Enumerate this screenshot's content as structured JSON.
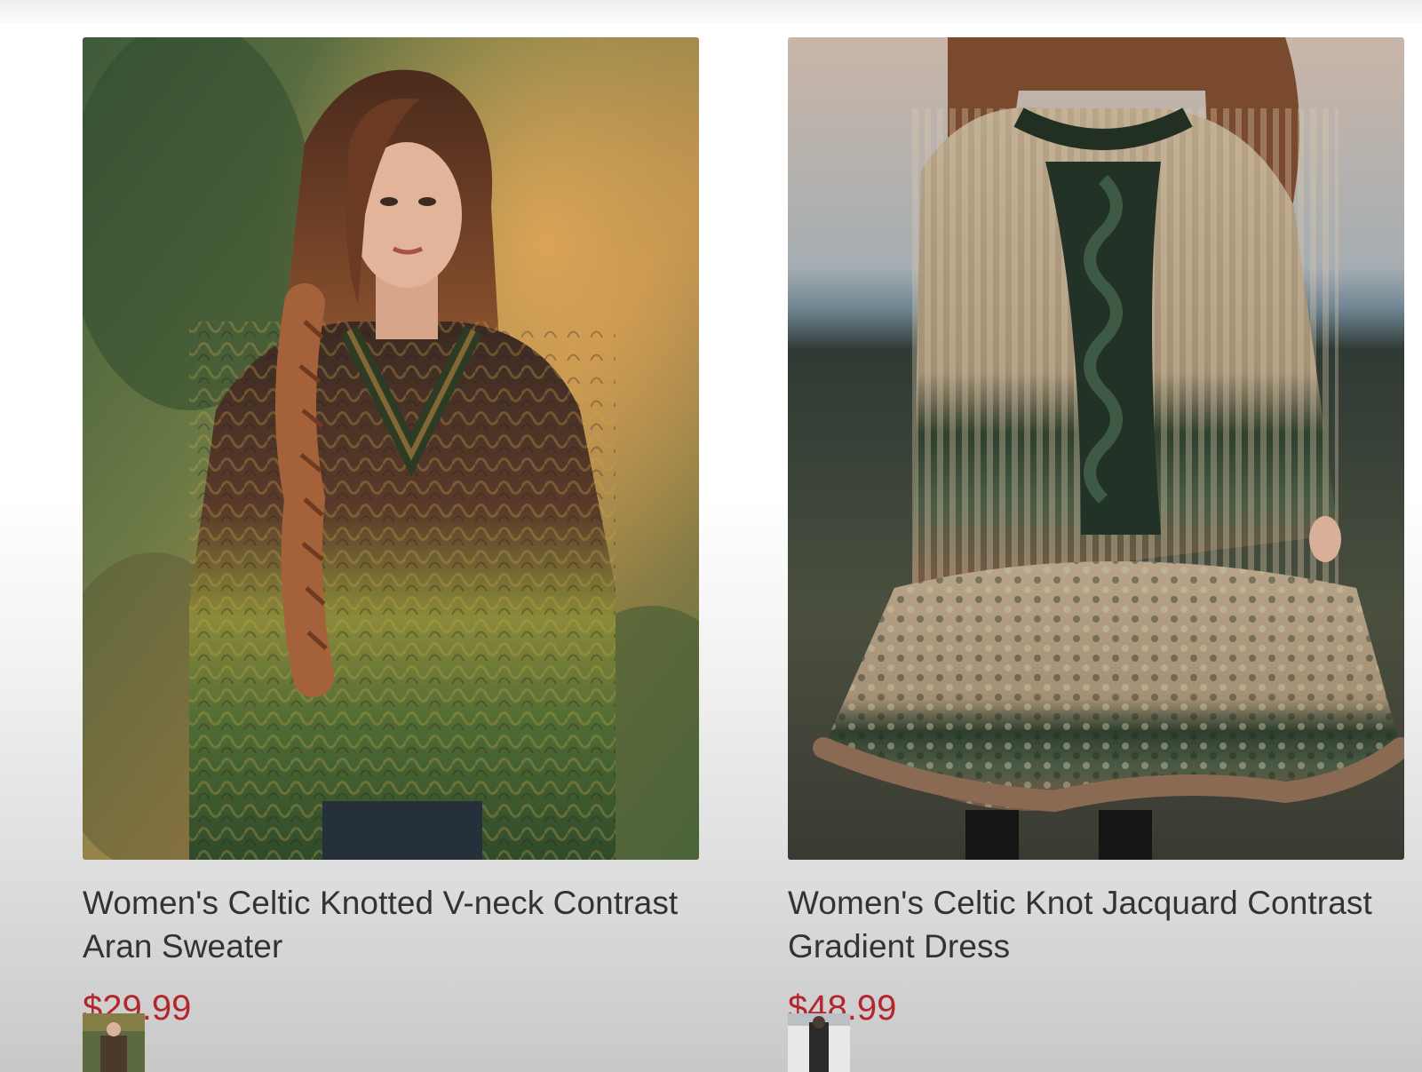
{
  "products": [
    {
      "title": "Women's Celtic Knotted V-neck Contrast Aran Sweater",
      "price": "$29.99",
      "image_icon": "sweater-photo",
      "thumbnail_icon": "sweater-thumbnail"
    },
    {
      "title": "Women's Celtic Knot Jacquard Contrast Gradient Dress",
      "price": "$48.99",
      "image_icon": "dress-photo",
      "thumbnail_icon": "dress-thumbnail"
    }
  ],
  "colors": {
    "price": "#b3262d",
    "title": "#333333"
  }
}
